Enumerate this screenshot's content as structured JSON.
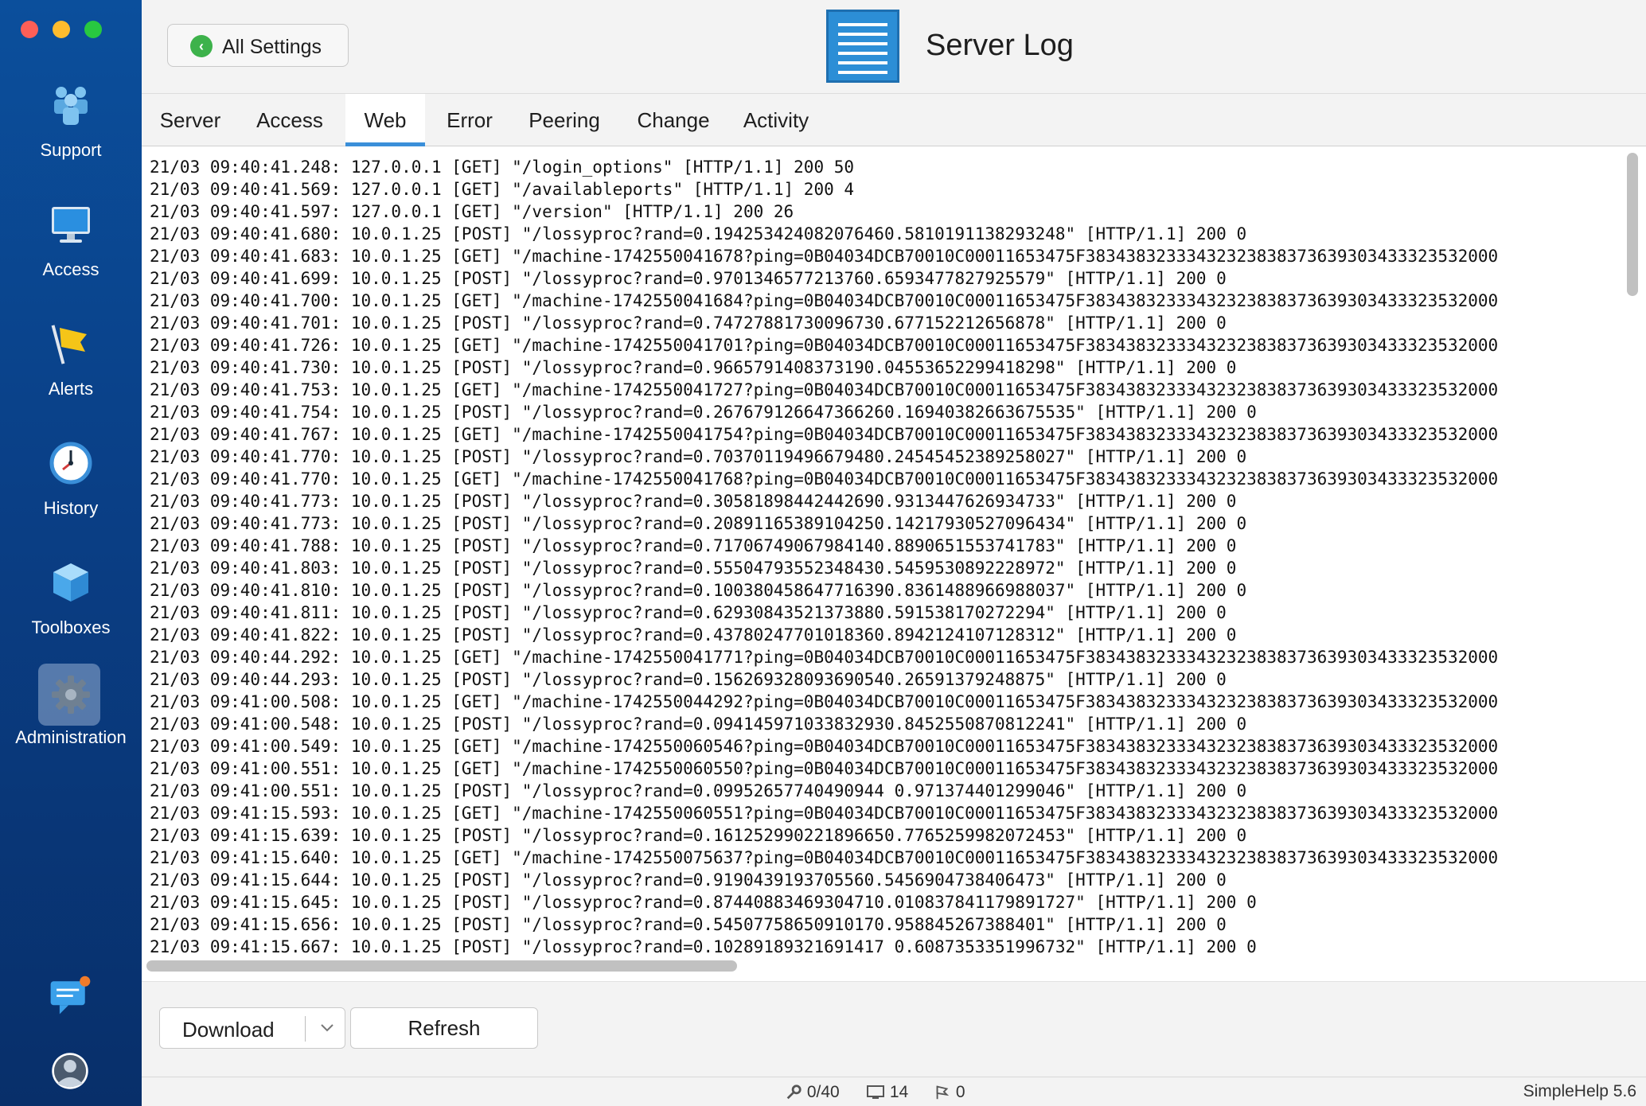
{
  "window": {
    "title": "Server Log"
  },
  "header": {
    "back_label": "All Settings",
    "title": "Server Log"
  },
  "sidebar": {
    "items": [
      {
        "label": "Support",
        "icon": "people-icon"
      },
      {
        "label": "Access",
        "icon": "monitor-icon"
      },
      {
        "label": "Alerts",
        "icon": "flag-icon"
      },
      {
        "label": "History",
        "icon": "clock-icon"
      },
      {
        "label": "Toolboxes",
        "icon": "cube-icon"
      },
      {
        "label": "Administration",
        "icon": "gear-icon",
        "active": true
      }
    ],
    "bottom": [
      {
        "icon": "chat-icon",
        "has_notification": true
      },
      {
        "icon": "user-avatar-icon"
      }
    ]
  },
  "tabs": [
    {
      "label": "Server"
    },
    {
      "label": "Access"
    },
    {
      "label": "Web",
      "active": true
    },
    {
      "label": "Error"
    },
    {
      "label": "Peering"
    },
    {
      "label": "Change"
    },
    {
      "label": "Activity"
    }
  ],
  "log_lines": [
    "21/03 09:40:41.248: 127.0.0.1 [GET] \"/login_options\" [HTTP/1.1] 200 50",
    "21/03 09:40:41.569: 127.0.0.1 [GET] \"/availableports\" [HTTP/1.1] 200 4",
    "21/03 09:40:41.597: 127.0.0.1 [GET] \"/version\" [HTTP/1.1] 200 26",
    "21/03 09:40:41.680: 10.0.1.25 [POST] \"/lossyproc?rand=0.194253424082076460.5810191138293248\" [HTTP/1.1] 200 0",
    "21/03 09:40:41.683: 10.0.1.25 [GET] \"/machine-1742550041678?ping=0B04034DCB70010C00011653475F38343832333432323838373639303433323532000",
    "21/03 09:40:41.699: 10.0.1.25 [POST] \"/lossyproc?rand=0.9701346577213760.6593477827925579\" [HTTP/1.1] 200 0",
    "21/03 09:40:41.700: 10.0.1.25 [GET] \"/machine-1742550041684?ping=0B04034DCB70010C00011653475F38343832333432323838373639303433323532000",
    "21/03 09:40:41.701: 10.0.1.25 [POST] \"/lossyproc?rand=0.74727881730096730.677152212656878\" [HTTP/1.1] 200 0",
    "21/03 09:40:41.726: 10.0.1.25 [GET] \"/machine-1742550041701?ping=0B04034DCB70010C00011653475F38343832333432323838373639303433323532000",
    "21/03 09:40:41.730: 10.0.1.25 [POST] \"/lossyproc?rand=0.9665791408373190.04553652299418298\" [HTTP/1.1] 200 0",
    "21/03 09:40:41.753: 10.0.1.25 [GET] \"/machine-1742550041727?ping=0B04034DCB70010C00011653475F38343832333432323838373639303433323532000",
    "21/03 09:40:41.754: 10.0.1.25 [POST] \"/lossyproc?rand=0.267679126647366260.16940382663675535\" [HTTP/1.1] 200 0",
    "21/03 09:40:41.767: 10.0.1.25 [GET] \"/machine-1742550041754?ping=0B04034DCB70010C00011653475F38343832333432323838373639303433323532000",
    "21/03 09:40:41.770: 10.0.1.25 [POST] \"/lossyproc?rand=0.70370119496679480.24545452389258027\" [HTTP/1.1] 200 0",
    "21/03 09:40:41.770: 10.0.1.25 [GET] \"/machine-1742550041768?ping=0B04034DCB70010C00011653475F38343832333432323838373639303433323532000",
    "21/03 09:40:41.773: 10.0.1.25 [POST] \"/lossyproc?rand=0.30581898442442690.9313447626934733\" [HTTP/1.1] 200 0",
    "21/03 09:40:41.773: 10.0.1.25 [POST] \"/lossyproc?rand=0.20891165389104250.14217930527096434\" [HTTP/1.1] 200 0",
    "21/03 09:40:41.788: 10.0.1.25 [POST] \"/lossyproc?rand=0.71706749067984140.8890651553741783\" [HTTP/1.1] 200 0",
    "21/03 09:40:41.803: 10.0.1.25 [POST] \"/lossyproc?rand=0.55504793552348430.5459530892228972\" [HTTP/1.1] 200 0",
    "21/03 09:40:41.810: 10.0.1.25 [POST] \"/lossyproc?rand=0.100380458647716390.8361488966988037\" [HTTP/1.1] 200 0",
    "21/03 09:40:41.811: 10.0.1.25 [POST] \"/lossyproc?rand=0.62930843521373880.591538170272294\" [HTTP/1.1] 200 0",
    "21/03 09:40:41.822: 10.0.1.25 [POST] \"/lossyproc?rand=0.43780247701018360.8942124107128312\" [HTTP/1.1] 200 0",
    "21/03 09:40:44.292: 10.0.1.25 [GET] \"/machine-1742550041771?ping=0B04034DCB70010C00011653475F38343832333432323838373639303433323532000",
    "21/03 09:40:44.293: 10.0.1.25 [POST] \"/lossyproc?rand=0.156269328093690540.26591379248875\" [HTTP/1.1] 200 0",
    "21/03 09:41:00.508: 10.0.1.25 [GET] \"/machine-1742550044292?ping=0B04034DCB70010C00011653475F38343832333432323838373639303433323532000",
    "21/03 09:41:00.548: 10.0.1.25 [POST] \"/lossyproc?rand=0.094145971033832930.8452550870812241\" [HTTP/1.1] 200 0",
    "21/03 09:41:00.549: 10.0.1.25 [GET] \"/machine-1742550060546?ping=0B04034DCB70010C00011653475F38343832333432323838373639303433323532000",
    "21/03 09:41:00.551: 10.0.1.25 [GET] \"/machine-1742550060550?ping=0B04034DCB70010C00011653475F38343832333432323838373639303433323532000",
    "21/03 09:41:00.551: 10.0.1.25 [POST] \"/lossyproc?rand=0.09952657740490944 0.971374401299046\" [HTTP/1.1] 200 0",
    "21/03 09:41:15.593: 10.0.1.25 [GET] \"/machine-1742550060551?ping=0B04034DCB70010C00011653475F38343832333432323838373639303433323532000",
    "21/03 09:41:15.639: 10.0.1.25 [POST] \"/lossyproc?rand=0.161252990221896650.7765259982072453\" [HTTP/1.1] 200 0",
    "21/03 09:41:15.640: 10.0.1.25 [GET] \"/machine-1742550075637?ping=0B04034DCB70010C00011653475F38343832333432323838373639303433323532000",
    "21/03 09:41:15.644: 10.0.1.25 [POST] \"/lossyproc?rand=0.9190439193705560.5456904738406473\" [HTTP/1.1] 200 0",
    "21/03 09:41:15.645: 10.0.1.25 [POST] \"/lossyproc?rand=0.87440883469304710.010837841179891727\" [HTTP/1.1] 200 0",
    "21/03 09:41:15.656: 10.0.1.25 [POST] \"/lossyproc?rand=0.54507758650910170.958845267388401\" [HTTP/1.1] 200 0",
    "21/03 09:41:15.667: 10.0.1.25 [POST] \"/lossyproc?rand=0.10289189321691417 0.6087353351996732\" [HTTP/1.1] 200 0"
  ],
  "buttons": {
    "download": "Download",
    "refresh": "Refresh"
  },
  "status": {
    "technicians": "0/40",
    "machines": "14",
    "alerts": "0",
    "version": "SimpleHelp 5.6"
  },
  "colors": {
    "sidebar": "#0a3f86",
    "accent": "#3a8fd9",
    "back_button_green": "#3db24b"
  }
}
